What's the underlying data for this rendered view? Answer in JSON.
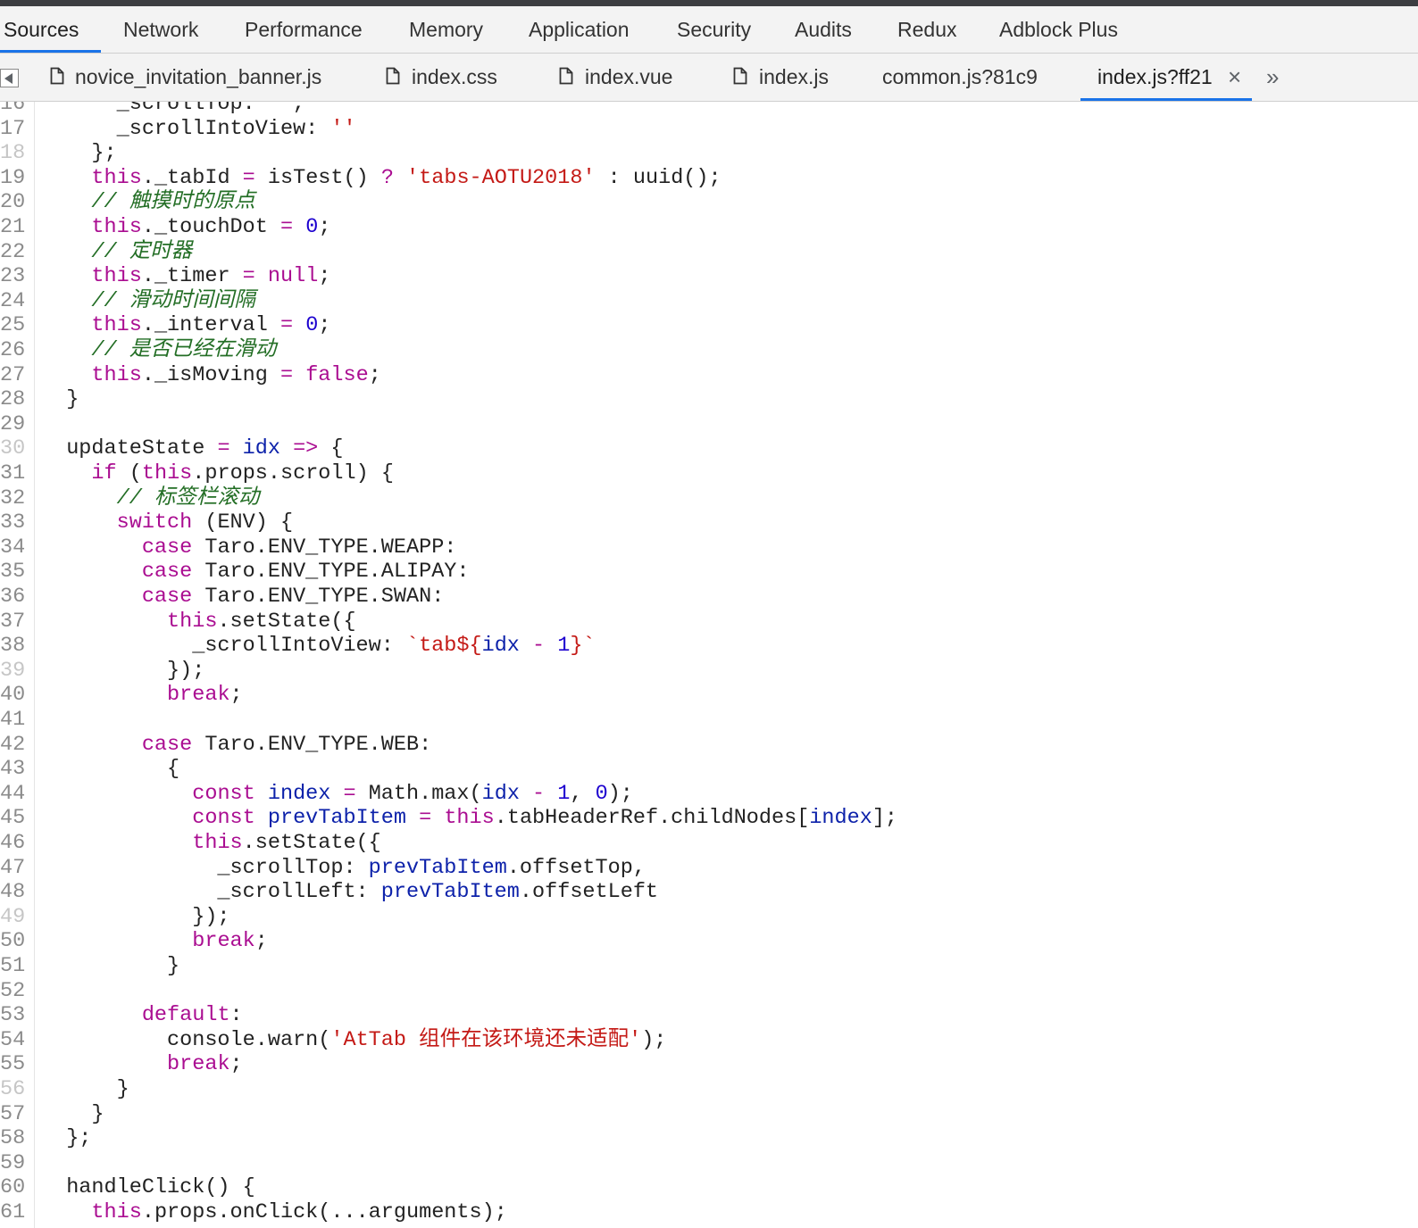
{
  "panel_tabs": [
    {
      "label": "Sources",
      "active": true
    },
    {
      "label": "Network"
    },
    {
      "label": "Performance"
    },
    {
      "label": "Memory"
    },
    {
      "label": "Application"
    },
    {
      "label": "Security"
    },
    {
      "label": "Audits"
    },
    {
      "label": "Redux"
    },
    {
      "label": "Adblock Plus"
    }
  ],
  "file_tabs": [
    {
      "label": "novice_invitation_banner.js",
      "icon": "file-icon"
    },
    {
      "label": "index.css",
      "icon": "file-icon"
    },
    {
      "label": "index.vue",
      "icon": "file-icon"
    },
    {
      "label": "index.js",
      "icon": "file-icon"
    },
    {
      "label": "common.js?81c9"
    },
    {
      "label": "index.js?ff21",
      "active": true
    }
  ],
  "file_tab_close": "×",
  "more_tabs": "»",
  "colors": {
    "keyword": "#aa0d91",
    "string": "#c41a16",
    "number": "#1c00cf",
    "variable": "#0d22aa",
    "comment": "#236e25",
    "active_tab_underline": "#1a73e8"
  },
  "code_lines": [
    {
      "no": "16",
      "tokens": [
        {
          "t": "      _scrollTop: '',"
        }
      ]
    },
    {
      "no": "17",
      "tokens": [
        {
          "t": "      _scrollIntoView: "
        },
        {
          "t": "''",
          "c": "s"
        }
      ]
    },
    {
      "no": "18",
      "dim": true,
      "tokens": [
        {
          "t": "    };"
        }
      ]
    },
    {
      "no": "19",
      "tokens": [
        {
          "t": "    "
        },
        {
          "t": "this",
          "c": "kw"
        },
        {
          "t": "._tabId "
        },
        {
          "t": "=",
          "c": "kw"
        },
        {
          "t": " isTest() "
        },
        {
          "t": "?",
          "c": "kw"
        },
        {
          "t": " "
        },
        {
          "t": "'tabs-AOTU2018'",
          "c": "s"
        },
        {
          "t": " : uuid();"
        }
      ]
    },
    {
      "no": "20",
      "tokens": [
        {
          "t": "    "
        },
        {
          "t": "// 触摸时的原点",
          "c": "c"
        }
      ]
    },
    {
      "no": "21",
      "tokens": [
        {
          "t": "    "
        },
        {
          "t": "this",
          "c": "kw"
        },
        {
          "t": "._touchDot "
        },
        {
          "t": "=",
          "c": "kw"
        },
        {
          "t": " "
        },
        {
          "t": "0",
          "c": "n"
        },
        {
          "t": ";"
        }
      ]
    },
    {
      "no": "22",
      "tokens": [
        {
          "t": "    "
        },
        {
          "t": "// 定时器",
          "c": "c"
        }
      ]
    },
    {
      "no": "23",
      "tokens": [
        {
          "t": "    "
        },
        {
          "t": "this",
          "c": "kw"
        },
        {
          "t": "._timer "
        },
        {
          "t": "=",
          "c": "kw"
        },
        {
          "t": " "
        },
        {
          "t": "null",
          "c": "kw"
        },
        {
          "t": ";"
        }
      ]
    },
    {
      "no": "24",
      "tokens": [
        {
          "t": "    "
        },
        {
          "t": "// 滑动时间间隔",
          "c": "c"
        }
      ]
    },
    {
      "no": "25",
      "tokens": [
        {
          "t": "    "
        },
        {
          "t": "this",
          "c": "kw"
        },
        {
          "t": "._interval "
        },
        {
          "t": "=",
          "c": "kw"
        },
        {
          "t": " "
        },
        {
          "t": "0",
          "c": "n"
        },
        {
          "t": ";"
        }
      ]
    },
    {
      "no": "26",
      "tokens": [
        {
          "t": "    "
        },
        {
          "t": "// 是否已经在滑动",
          "c": "c"
        }
      ]
    },
    {
      "no": "27",
      "tokens": [
        {
          "t": "    "
        },
        {
          "t": "this",
          "c": "kw"
        },
        {
          "t": "._isMoving "
        },
        {
          "t": "=",
          "c": "kw"
        },
        {
          "t": " "
        },
        {
          "t": "false",
          "c": "kw"
        },
        {
          "t": ";"
        }
      ]
    },
    {
      "no": "28",
      "tokens": [
        {
          "t": "  }"
        }
      ]
    },
    {
      "no": "29",
      "tokens": [
        {
          "t": ""
        }
      ]
    },
    {
      "no": "30",
      "dim": true,
      "tokens": [
        {
          "t": "  updateState "
        },
        {
          "t": "=",
          "c": "kw"
        },
        {
          "t": " "
        },
        {
          "t": "idx",
          "c": "v"
        },
        {
          "t": " "
        },
        {
          "t": "=>",
          "c": "kw"
        },
        {
          "t": " {"
        }
      ]
    },
    {
      "no": "31",
      "tokens": [
        {
          "t": "    "
        },
        {
          "t": "if",
          "c": "kw"
        },
        {
          "t": " ("
        },
        {
          "t": "this",
          "c": "kw"
        },
        {
          "t": ".props.scroll) {"
        }
      ]
    },
    {
      "no": "32",
      "tokens": [
        {
          "t": "      "
        },
        {
          "t": "// 标签栏滚动",
          "c": "c"
        }
      ]
    },
    {
      "no": "33",
      "tokens": [
        {
          "t": "      "
        },
        {
          "t": "switch",
          "c": "kw"
        },
        {
          "t": " (ENV) {"
        }
      ]
    },
    {
      "no": "34",
      "tokens": [
        {
          "t": "        "
        },
        {
          "t": "case",
          "c": "kw"
        },
        {
          "t": " Taro.ENV_TYPE.WEAPP:"
        }
      ]
    },
    {
      "no": "35",
      "tokens": [
        {
          "t": "        "
        },
        {
          "t": "case",
          "c": "kw"
        },
        {
          "t": " Taro.ENV_TYPE.ALIPAY:"
        }
      ]
    },
    {
      "no": "36",
      "tokens": [
        {
          "t": "        "
        },
        {
          "t": "case",
          "c": "kw"
        },
        {
          "t": " Taro.ENV_TYPE.SWAN:"
        }
      ]
    },
    {
      "no": "37",
      "tokens": [
        {
          "t": "          "
        },
        {
          "t": "this",
          "c": "kw"
        },
        {
          "t": ".setState({"
        }
      ]
    },
    {
      "no": "38",
      "tokens": [
        {
          "t": "            _scrollIntoView: "
        },
        {
          "t": "`tab${",
          "c": "s"
        },
        {
          "t": "idx",
          "c": "v"
        },
        {
          "t": " "
        },
        {
          "t": "-",
          "c": "kw"
        },
        {
          "t": " "
        },
        {
          "t": "1",
          "c": "n"
        },
        {
          "t": "}`",
          "c": "s"
        }
      ]
    },
    {
      "no": "39",
      "dim": true,
      "tokens": [
        {
          "t": "          });"
        }
      ]
    },
    {
      "no": "40",
      "tokens": [
        {
          "t": "          "
        },
        {
          "t": "break",
          "c": "kw"
        },
        {
          "t": ";"
        }
      ]
    },
    {
      "no": "41",
      "tokens": [
        {
          "t": ""
        }
      ]
    },
    {
      "no": "42",
      "tokens": [
        {
          "t": "        "
        },
        {
          "t": "case",
          "c": "kw"
        },
        {
          "t": " Taro.ENV_TYPE.WEB:"
        }
      ]
    },
    {
      "no": "43",
      "tokens": [
        {
          "t": "          {"
        }
      ]
    },
    {
      "no": "44",
      "tokens": [
        {
          "t": "            "
        },
        {
          "t": "const",
          "c": "kw"
        },
        {
          "t": " "
        },
        {
          "t": "index",
          "c": "v"
        },
        {
          "t": " "
        },
        {
          "t": "=",
          "c": "kw"
        },
        {
          "t": " Math.max("
        },
        {
          "t": "idx",
          "c": "v"
        },
        {
          "t": " "
        },
        {
          "t": "-",
          "c": "kw"
        },
        {
          "t": " "
        },
        {
          "t": "1",
          "c": "n"
        },
        {
          "t": ", "
        },
        {
          "t": "0",
          "c": "n"
        },
        {
          "t": ");"
        }
      ]
    },
    {
      "no": "45",
      "tokens": [
        {
          "t": "            "
        },
        {
          "t": "const",
          "c": "kw"
        },
        {
          "t": " "
        },
        {
          "t": "prevTabItem",
          "c": "v"
        },
        {
          "t": " "
        },
        {
          "t": "=",
          "c": "kw"
        },
        {
          "t": " "
        },
        {
          "t": "this",
          "c": "kw"
        },
        {
          "t": ".tabHeaderRef.childNodes["
        },
        {
          "t": "index",
          "c": "v"
        },
        {
          "t": "];"
        }
      ]
    },
    {
      "no": "46",
      "tokens": [
        {
          "t": "            "
        },
        {
          "t": "this",
          "c": "kw"
        },
        {
          "t": ".setState({"
        }
      ]
    },
    {
      "no": "47",
      "tokens": [
        {
          "t": "              _scrollTop: "
        },
        {
          "t": "prevTabItem",
          "c": "v"
        },
        {
          "t": ".offsetTop,"
        }
      ]
    },
    {
      "no": "48",
      "tokens": [
        {
          "t": "              _scrollLeft: "
        },
        {
          "t": "prevTabItem",
          "c": "v"
        },
        {
          "t": ".offsetLeft"
        }
      ]
    },
    {
      "no": "49",
      "dim": true,
      "tokens": [
        {
          "t": "            });"
        }
      ]
    },
    {
      "no": "50",
      "tokens": [
        {
          "t": "            "
        },
        {
          "t": "break",
          "c": "kw"
        },
        {
          "t": ";"
        }
      ]
    },
    {
      "no": "51",
      "tokens": [
        {
          "t": "          }"
        }
      ]
    },
    {
      "no": "52",
      "tokens": [
        {
          "t": ""
        }
      ]
    },
    {
      "no": "53",
      "tokens": [
        {
          "t": "        "
        },
        {
          "t": "default",
          "c": "kw"
        },
        {
          "t": ":"
        }
      ]
    },
    {
      "no": "54",
      "tokens": [
        {
          "t": "          console.warn("
        },
        {
          "t": "'AtTab 组件在该环境还未适配'",
          "c": "s"
        },
        {
          "t": ");"
        }
      ]
    },
    {
      "no": "55",
      "tokens": [
        {
          "t": "          "
        },
        {
          "t": "break",
          "c": "kw"
        },
        {
          "t": ";"
        }
      ]
    },
    {
      "no": "56",
      "dim": true,
      "tokens": [
        {
          "t": "      }"
        }
      ]
    },
    {
      "no": "57",
      "tokens": [
        {
          "t": "    }"
        }
      ]
    },
    {
      "no": "58",
      "tokens": [
        {
          "t": "  };"
        }
      ]
    },
    {
      "no": "59",
      "tokens": [
        {
          "t": ""
        }
      ]
    },
    {
      "no": "60",
      "tokens": [
        {
          "t": "  handleClick() {"
        }
      ]
    },
    {
      "no": "61",
      "tokens": [
        {
          "t": "    "
        },
        {
          "t": "this",
          "c": "kw"
        },
        {
          "t": ".props.onClick(...arguments);"
        }
      ]
    }
  ]
}
